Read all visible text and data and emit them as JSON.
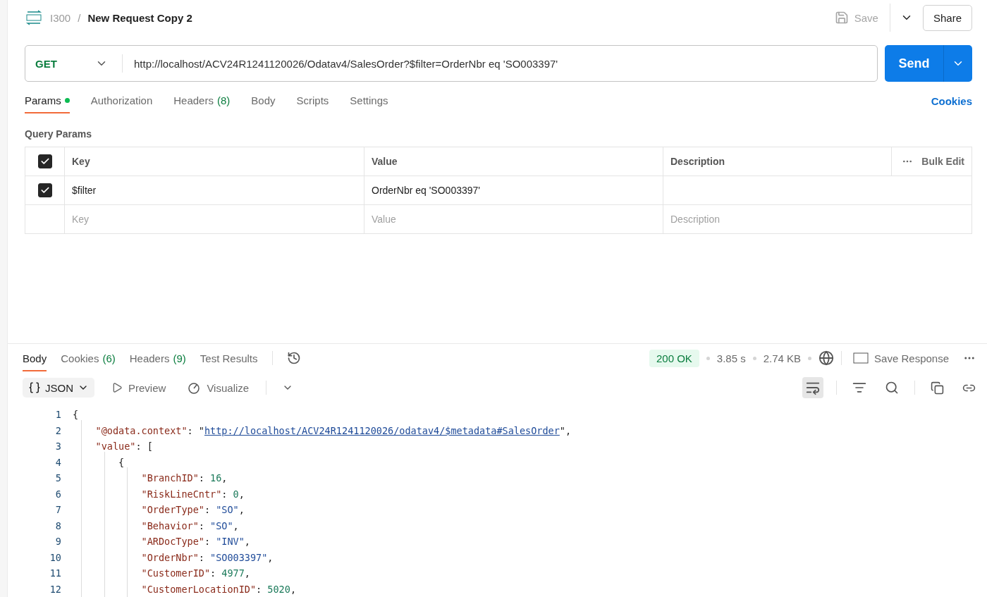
{
  "breadcrumb": {
    "collection": "I300",
    "separator": "/",
    "request": "New Request Copy 2"
  },
  "header_actions": {
    "save": "Save",
    "share": "Share"
  },
  "request": {
    "method": "GET",
    "url": "http://localhost/ACV24R1241120026/Odatav4/SalesOrder?$filter=OrderNbr eq 'SO003397'",
    "send": "Send"
  },
  "request_tabs": [
    {
      "label": "Params",
      "dot": true,
      "selected": true
    },
    {
      "label": "Authorization",
      "dot": false,
      "selected": false
    },
    {
      "label": "Headers",
      "count": "(8)",
      "dot": false,
      "selected": false
    },
    {
      "label": "Body",
      "dot": false,
      "selected": false
    },
    {
      "label": "Scripts",
      "dot": false,
      "selected": false
    },
    {
      "label": "Settings",
      "dot": false,
      "selected": false
    }
  ],
  "cookies_link": "Cookies",
  "query_params": {
    "title": "Query Params",
    "header_checked": true,
    "columns": [
      "Key",
      "Value",
      "Description"
    ],
    "bulk_edit": "Bulk Edit",
    "rows": [
      {
        "checked": true,
        "key": "$filter",
        "value": "OrderNbr eq 'SO003397'"
      }
    ],
    "placeholder_row": {
      "key": "Key",
      "value": "Value",
      "description": "Description"
    }
  },
  "response_tabs": [
    {
      "label": "Body",
      "selected": true
    },
    {
      "label": "Cookies",
      "count": "(6)",
      "selected": false
    },
    {
      "label": "Headers",
      "count": "(9)",
      "selected": false
    },
    {
      "label": "Test Results",
      "selected": false
    }
  ],
  "response_meta": {
    "status": "200 OK",
    "time": "3.85 s",
    "size": "2.74 KB",
    "save_response": "Save Response"
  },
  "view_toolbar": {
    "format": "JSON",
    "preview": "Preview",
    "visualize": "Visualize",
    "wrap_on": true
  },
  "code_lines": [
    {
      "number": "1",
      "tokens": [
        {
          "kind": "punct",
          "text": "{"
        }
      ],
      "children": [
        {
          "number": "2",
          "tokens": [
            {
              "kind": "key",
              "text": "\"@odata.context\""
            },
            {
              "kind": "punct",
              "text": ": \""
            },
            {
              "kind": "link",
              "text": "http://localhost/ACV24R1241120026/odatav4/$metadata#SalesOrder"
            },
            {
              "kind": "punct",
              "text": "\","
            }
          ]
        },
        {
          "number": "3",
          "tokens": [
            {
              "kind": "key",
              "text": "\"value\""
            },
            {
              "kind": "punct",
              "text": ": ["
            }
          ],
          "children": [
            {
              "number": "4",
              "tokens": [
                {
                  "kind": "punct",
                  "text": "{"
                }
              ],
              "children": [
                {
                  "number": "5",
                  "tokens": [
                    {
                      "kind": "key",
                      "text": "\"BranchID\""
                    },
                    {
                      "kind": "punct",
                      "text": ": "
                    },
                    {
                      "kind": "number",
                      "text": "16"
                    },
                    {
                      "kind": "punct",
                      "text": ","
                    }
                  ]
                },
                {
                  "number": "6",
                  "tokens": [
                    {
                      "kind": "key",
                      "text": "\"RiskLineCntr\""
                    },
                    {
                      "kind": "punct",
                      "text": ": "
                    },
                    {
                      "kind": "number",
                      "text": "0"
                    },
                    {
                      "kind": "punct",
                      "text": ","
                    }
                  ]
                },
                {
                  "number": "7",
                  "tokens": [
                    {
                      "kind": "key",
                      "text": "\"OrderType\""
                    },
                    {
                      "kind": "punct",
                      "text": ": "
                    },
                    {
                      "kind": "string",
                      "text": "\"SO\""
                    },
                    {
                      "kind": "punct",
                      "text": ","
                    }
                  ]
                },
                {
                  "number": "8",
                  "tokens": [
                    {
                      "kind": "key",
                      "text": "\"Behavior\""
                    },
                    {
                      "kind": "punct",
                      "text": ": "
                    },
                    {
                      "kind": "string",
                      "text": "\"SO\""
                    },
                    {
                      "kind": "punct",
                      "text": ","
                    }
                  ]
                },
                {
                  "number": "9",
                  "tokens": [
                    {
                      "kind": "key",
                      "text": "\"ARDocType\""
                    },
                    {
                      "kind": "punct",
                      "text": ": "
                    },
                    {
                      "kind": "string",
                      "text": "\"INV\""
                    },
                    {
                      "kind": "punct",
                      "text": ","
                    }
                  ]
                },
                {
                  "number": "10",
                  "tokens": [
                    {
                      "kind": "key",
                      "text": "\"OrderNbr\""
                    },
                    {
                      "kind": "punct",
                      "text": ": "
                    },
                    {
                      "kind": "string",
                      "text": "\"SO003397\""
                    },
                    {
                      "kind": "punct",
                      "text": ","
                    }
                  ]
                },
                {
                  "number": "11",
                  "tokens": [
                    {
                      "kind": "key",
                      "text": "\"CustomerID\""
                    },
                    {
                      "kind": "punct",
                      "text": ": "
                    },
                    {
                      "kind": "number",
                      "text": "4977"
                    },
                    {
                      "kind": "punct",
                      "text": ","
                    }
                  ]
                },
                {
                  "number": "12",
                  "tokens": [
                    {
                      "kind": "key",
                      "text": "\"CustomerLocationID\""
                    },
                    {
                      "kind": "punct",
                      "text": ": "
                    },
                    {
                      "kind": "number",
                      "text": "5020"
                    },
                    {
                      "kind": "punct",
                      "text": ","
                    }
                  ]
                }
              ]
            }
          ]
        }
      ]
    }
  ]
}
